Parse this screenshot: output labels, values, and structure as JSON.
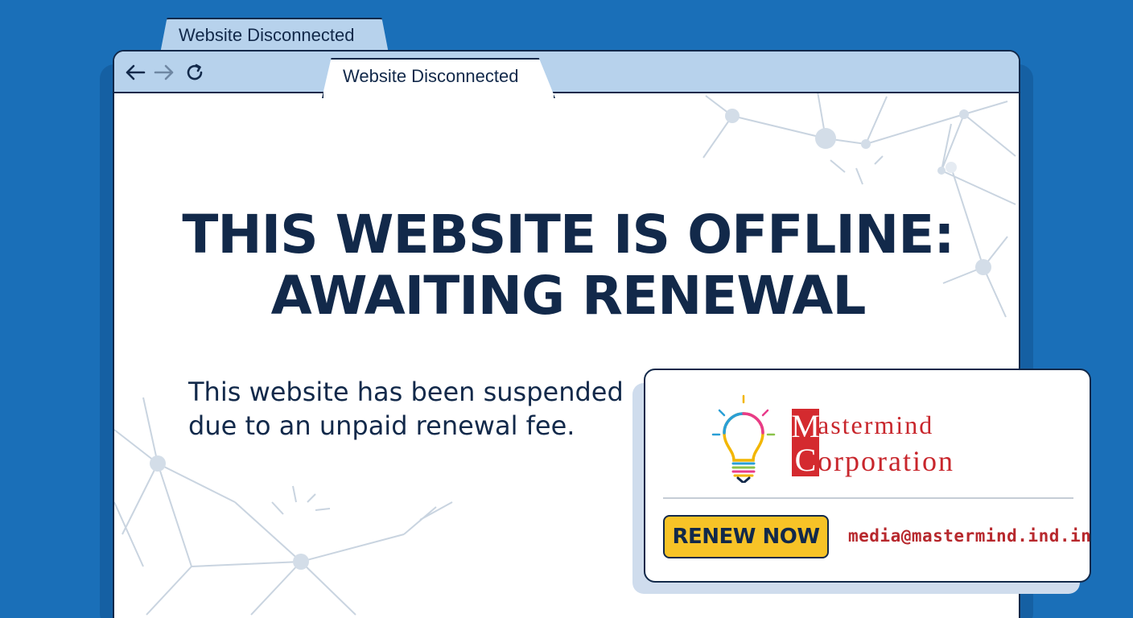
{
  "browser": {
    "back_tab_title": "Website Disconnected",
    "active_tab_title": "Website Disconnected",
    "nav": {
      "back_icon": "arrow-left-icon",
      "forward_icon": "arrow-right-icon",
      "reload_icon": "reload-icon"
    }
  },
  "page": {
    "headline_line1": "THIS WEBSITE IS OFFLINE:",
    "headline_line2": "AWAITING RENEWAL",
    "subtitle_line1": "This website has been suspended",
    "subtitle_line2": "due to an unpaid renewal fee."
  },
  "card": {
    "logo": {
      "icon": "lightbulb-icon",
      "line1_initial": "M",
      "line1_rest": "astermind",
      "line2_initial": "C",
      "line2_rest": "orporation"
    },
    "renew_button": "RENEW NOW",
    "email": "media@mastermind.ind.in"
  },
  "colors": {
    "background": "#1a6fb8",
    "navy": "#12294a",
    "tab_blue": "#b7d2ec",
    "button_yellow": "#f7c327",
    "brand_red": "#c8262c"
  }
}
